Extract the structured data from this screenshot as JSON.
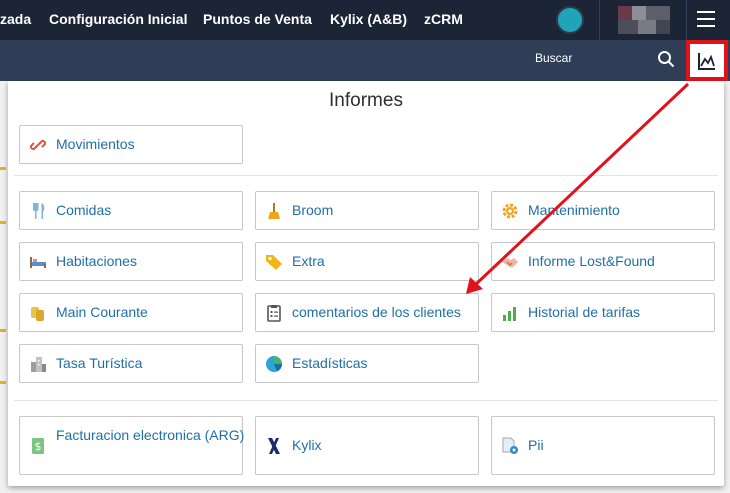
{
  "topnav": {
    "items": [
      "zada",
      "Configuración Inicial",
      "Puntos de Venta",
      "Kylix (A&B)",
      "zCRM"
    ]
  },
  "subbar": {
    "search_label": "Buscar"
  },
  "panel": {
    "title": "Informes",
    "sections": [
      {
        "tiles": [
          {
            "label": "Movimientos",
            "icon": "link-icon"
          }
        ]
      },
      {
        "tiles": [
          {
            "label": "Comidas",
            "icon": "cutlery-icon"
          },
          {
            "label": "Broom",
            "icon": "broom-icon"
          },
          {
            "label": "Mantenimiento",
            "icon": "gear-icon"
          },
          {
            "label": "Habitaciones",
            "icon": "bed-icon"
          },
          {
            "label": "Extra",
            "icon": "tag-icon"
          },
          {
            "label": "Informe Lost&Found",
            "icon": "handshake-icon"
          },
          {
            "label": "Main Courante",
            "icon": "coins-icon"
          },
          {
            "label": "comentarios de los clientes",
            "icon": "clipboard-icon"
          },
          {
            "label": "Historial de tarifas",
            "icon": "bar-chart-icon"
          },
          {
            "label": "Tasa Turística",
            "icon": "city-icon"
          },
          {
            "label": "Estadísticas",
            "icon": "pie-chart-icon"
          }
        ]
      },
      {
        "tiles": [
          {
            "label": "Facturacion electronica (ARG)",
            "icon": "dollar-note-icon"
          },
          {
            "label": "Kylix",
            "icon": "kylix-logo-icon"
          },
          {
            "label": "Pii",
            "icon": "document-gear-icon"
          }
        ]
      }
    ]
  },
  "colors": {
    "topbar": "#1c2536",
    "subbar": "#2f3e56",
    "link": "#1f6fa8",
    "highlight": "#e0121b"
  }
}
